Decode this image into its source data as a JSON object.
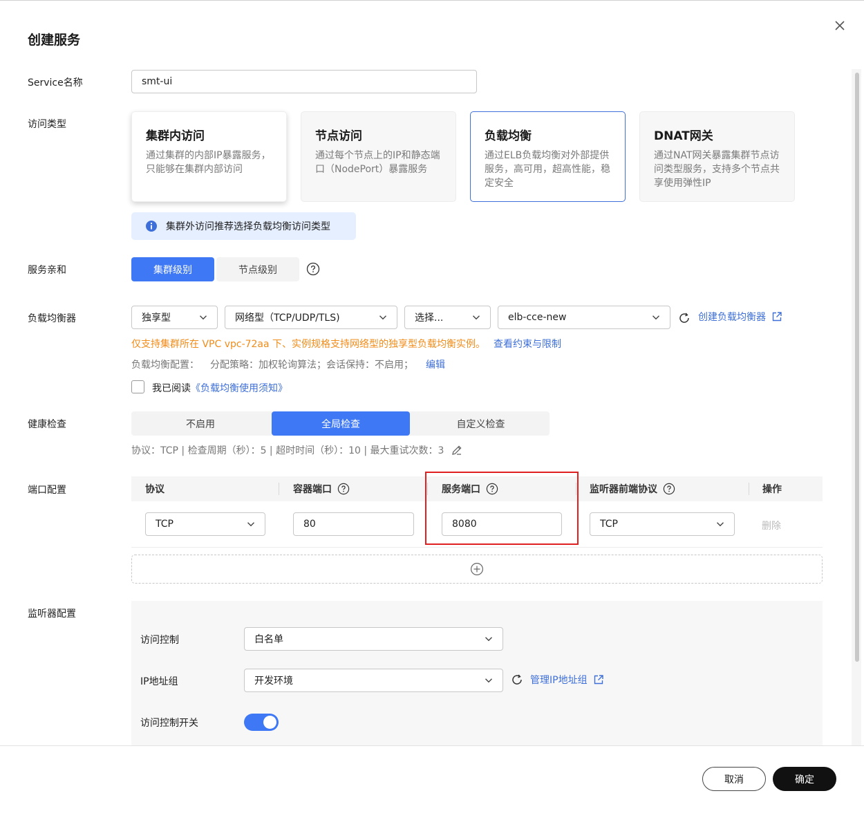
{
  "dialog": {
    "title": "创建服务"
  },
  "service_name": {
    "label": "Service名称",
    "value": "smt-ui"
  },
  "access_type": {
    "label": "访问类型",
    "cards": [
      {
        "title": "集群内访问",
        "desc": "通过集群的内部IP暴露服务，只能够在集群内部访问"
      },
      {
        "title": "节点访问",
        "desc": "通过每个节点上的IP和静态端口（NodePort）暴露服务"
      },
      {
        "title": "负载均衡",
        "desc": "通过ELB负载均衡对外部提供服务，高可用，超高性能，稳定安全"
      },
      {
        "title": "DNAT网关",
        "desc": "通过NAT网关暴露集群节点访问类型服务，支持多个节点共享使用弹性IP"
      }
    ],
    "selected": "负载均衡",
    "tip": "集群外访问推荐选择负载均衡访问类型"
  },
  "affinity": {
    "label": "服务亲和",
    "options": [
      "集群级别",
      "节点级别"
    ],
    "selected": "集群级别"
  },
  "load_balancer": {
    "label": "负载均衡器",
    "type_value": "独享型",
    "network_value": "网络型（TCP/UDP/TLS)",
    "spec_value": "选择...",
    "elb_value": "elb-cce-new",
    "create_link": "创建负载均衡器",
    "warning": "仅支持集群所在 VPC vpc-72aa 下、实例规格支持网络型的独享型负载均衡实例。",
    "constraints_link": "查看约束与限制",
    "config_label": "负载均衡配置：",
    "config_text": "分配策略：加权轮询算法；会话保持：不启用；",
    "edit_link": "编辑",
    "agree_text": "我已阅读",
    "agree_link": "《负载均衡使用须知》"
  },
  "health_check": {
    "label": "健康检查",
    "options": [
      "不启用",
      "全局检查",
      "自定义检查"
    ],
    "selected": "全局检查",
    "summary": "协议：TCP | 检查周期（秒）：5 | 超时时间（秒）：10 | 最大重试次数：3"
  },
  "ports": {
    "label": "端口配置",
    "headers": [
      "协议",
      "容器端口",
      "服务端口",
      "监听器前端协议",
      "操作"
    ],
    "rows": [
      {
        "protocol": "TCP",
        "container_port": "80",
        "service_port": "8080",
        "frontend_protocol": "TCP",
        "action": "删除"
      }
    ]
  },
  "listener": {
    "label": "监听器配置",
    "access_control_label": "访问控制",
    "access_control_value": "白名单",
    "ip_group_label": "IP地址组",
    "ip_group_value": "开发环境",
    "manage_link": "管理IP地址组",
    "switch_label": "访问控制开关",
    "switch_on": true
  },
  "footer": {
    "cancel": "取消",
    "ok": "确定"
  },
  "colors": {
    "primary": "#3e78f5",
    "link": "#3e6fd8",
    "warning": "#f08c1a",
    "highlight": "#e02020"
  }
}
